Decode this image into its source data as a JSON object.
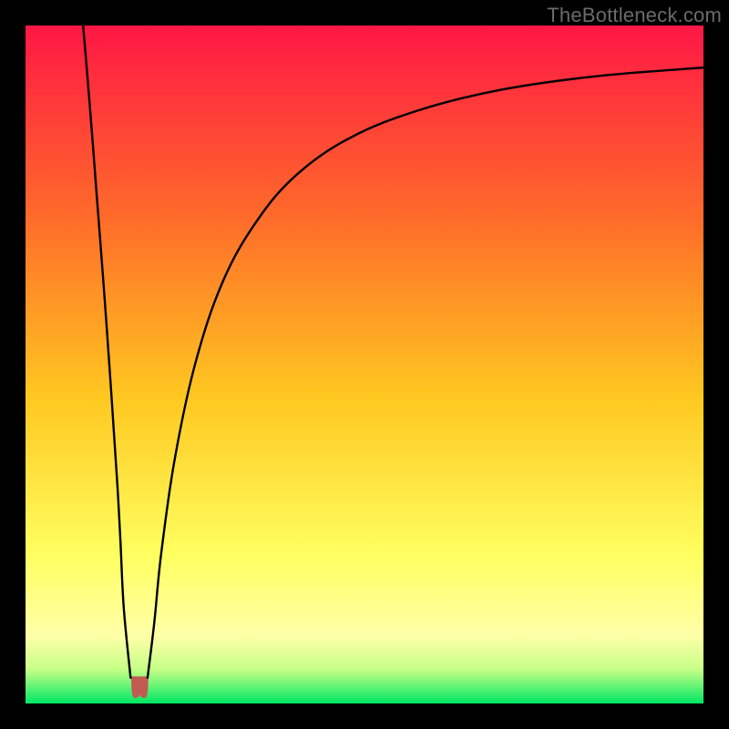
{
  "watermark": "TheBottleneck.com",
  "chart_data": {
    "type": "line",
    "title": "",
    "xlabel": "",
    "ylabel": "",
    "xlim": [
      0,
      100
    ],
    "ylim": [
      0,
      100
    ],
    "grid": false,
    "legend": false,
    "background_gradient": {
      "stops": [
        {
          "offset": 0.0,
          "color": "#ff1745"
        },
        {
          "offset": 0.28,
          "color": "#ff6a2a"
        },
        {
          "offset": 0.55,
          "color": "#ffc820"
        },
        {
          "offset": 0.78,
          "color": "#ffff60"
        },
        {
          "offset": 0.9,
          "color": "#ffffa8"
        },
        {
          "offset": 0.95,
          "color": "#c6ff87"
        },
        {
          "offset": 1.0,
          "color": "#00e763"
        }
      ]
    },
    "series": [
      {
        "name": "left-arm",
        "x": [
          8.5,
          9.5,
          10.5,
          11.5,
          12.5,
          13.5,
          14.0,
          14.5,
          15.5
        ],
        "values": [
          100,
          88,
          75,
          62,
          48,
          33,
          24,
          14,
          3.8
        ]
      },
      {
        "name": "right-arm",
        "x": [
          18.0,
          19.0,
          20.0,
          22.0,
          25.0,
          29.0,
          34.0,
          40.0,
          48.0,
          58.0,
          70.0,
          84.0,
          100.0
        ],
        "values": [
          3.8,
          12,
          22,
          36,
          50,
          62,
          71,
          78,
          83.5,
          87.5,
          90.5,
          92.5,
          93.8
        ]
      }
    ],
    "marker": {
      "name": "u-shape",
      "x": [
        15.8,
        16.3,
        17.4,
        17.9
      ],
      "y_top": [
        3.8,
        3.8,
        3.8,
        3.8
      ],
      "y_bottom": [
        1.0,
        1.5,
        1.5,
        1.0
      ],
      "color": "#c35a52"
    }
  }
}
